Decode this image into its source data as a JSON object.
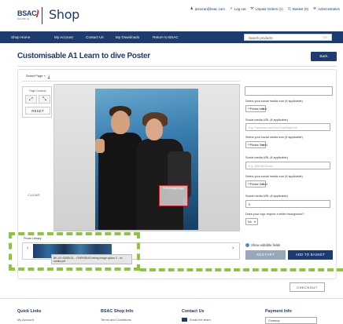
{
  "header": {
    "logo_text": "BSAC",
    "logo_sub": "Dive With Us",
    "shop_title": "Shop",
    "user_email": "jessicar@bsac.com",
    "logout": "Log out",
    "unpaid_orders": "Unpaid Orders (1)",
    "basket": "Basket (0)",
    "administration": "Administration"
  },
  "nav": {
    "items": [
      "Shop Home",
      "My Account",
      "Contact Us",
      "My Downloads",
      "Return to BSAC"
    ],
    "search_placeholder": "Search products",
    "search_go": "GO"
  },
  "page": {
    "title": "Customisable A1 Learn to dive Poster",
    "back_label": "Back"
  },
  "editor": {
    "select_page_label": "Select Page »",
    "select_page_value": "1",
    "page_controls_label": "Page Controls",
    "reset_label": "RESET",
    "clear_label": "CLEAR",
    "edit_logo_label": "Edit Image/Logo"
  },
  "form": {
    "icon_label_1": "Select your social media icon (if applicable)",
    "icon_select_1": "**Please select",
    "url_label_1": "Social media URL (if applicable)",
    "url_placeholder_1": "E.g. Facebook.com/YourClubPageLink",
    "icon_label_2": "Select your social media icon (if applicable)",
    "icon_select_2": "**Please Select",
    "url_label_2": "Social media URL (if applicable)",
    "url_placeholder_2": "E.g. @BSACDivers",
    "icon_label_3": "Select your social media icon (if applicable)",
    "icon_select_3": "**Please Select",
    "url_label_3": "Social media URL (if applicable)",
    "url_value_3": "€",
    "white_bg_label": "Does your logo require a white background?",
    "white_bg_value": "No",
    "show_editable": "Show editable fields",
    "restart_label": "RESTART",
    "add_basket_label": "ADD TO BASKET"
  },
  "library": {
    "label": "Photo Library",
    "tooltip": "BK-LR-43059-OL - OVERSEAS diving image option 2 - no marks.pdf"
  },
  "checkout_label": "CHECKOUT",
  "footer": {
    "quick_links": "Quick Links",
    "quick_first": "My Account",
    "info": "BSAC Shop Info",
    "info_first": "Terms and Conditions",
    "contact": "Contact Us",
    "contact_first": "Email the team",
    "payment": "Payment Info",
    "payment_select": "Currency"
  },
  "colors": {
    "brand_navy": "#1d3b6e",
    "brand_red": "#d52b2f",
    "callout_green": "#8cc63f",
    "edit_border": "#c62828"
  }
}
